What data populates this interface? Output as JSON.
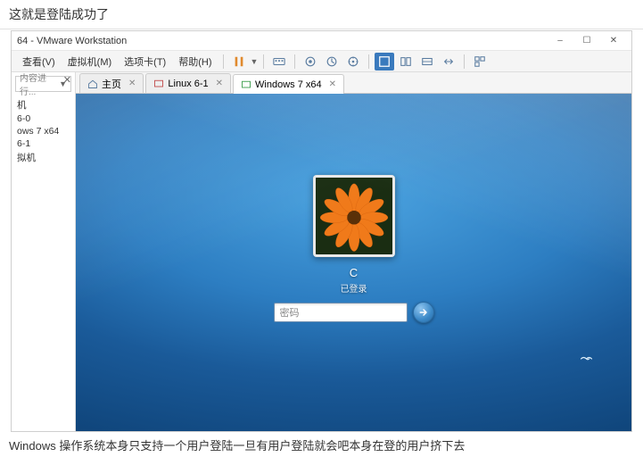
{
  "doc": {
    "top_text": "这就是登陆成功了",
    "bottom_text": "Windows 操作系统本身只支持一个用户登陆一旦有用户登陆就会吧本身在登的用户挤下去"
  },
  "window": {
    "title": "64 - VMware Workstation",
    "controls": {
      "min": "–",
      "max": "☐",
      "close": "✕"
    }
  },
  "menu": {
    "items": [
      "查看(V)",
      "虚拟机(M)",
      "选项卡(T)",
      "帮助(H)"
    ]
  },
  "toolbar_icons": {
    "pause": "pause-icon",
    "stop": "stop-icon",
    "play": "play-icon",
    "snapshot": "camera-icon",
    "revert": "clock-icon",
    "clock2": "clock-icon",
    "manage": "wrench-icon",
    "fullscreen": "fullscreen-icon",
    "unity": "unity-icon",
    "fit": "fit-icon",
    "stretch": "stretch-icon",
    "thumb": "thumb-icon"
  },
  "sidebar": {
    "search_placeholder": "内容进行...",
    "items": [
      "机",
      "6-0",
      "ows 7 x64",
      "6-1",
      "拟机"
    ]
  },
  "tabs": [
    {
      "label": "主页",
      "icon": "home",
      "active": false
    },
    {
      "label": "Linux 6-1",
      "icon": "vm",
      "active": false
    },
    {
      "label": "Windows 7 x64",
      "icon": "vm",
      "active": true
    }
  ],
  "login": {
    "username": "C",
    "status": "已登录",
    "password_placeholder": "密码"
  }
}
